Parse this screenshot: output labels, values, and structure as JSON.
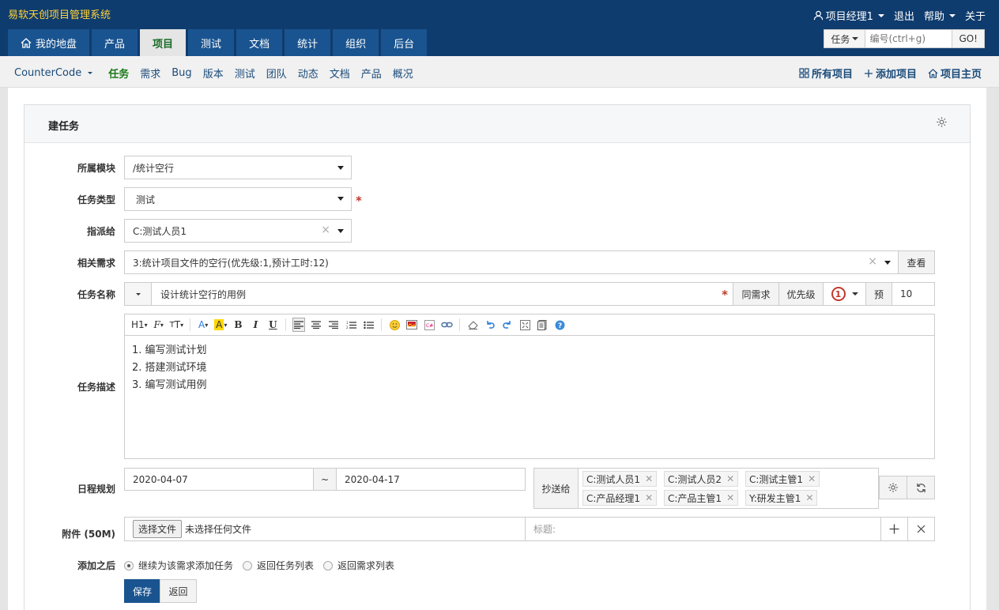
{
  "app": {
    "name": "易软天创项目管理系统"
  },
  "user_menu": {
    "user": "项目经理1",
    "logout": "退出",
    "help": "帮助",
    "about": "关于"
  },
  "main_nav": [
    {
      "label": "我的地盘",
      "active": false,
      "icon": "home-icon"
    },
    {
      "label": "产品",
      "active": false
    },
    {
      "label": "项目",
      "active": true
    },
    {
      "label": "测试",
      "active": false
    },
    {
      "label": "文档",
      "active": false
    },
    {
      "label": "统计",
      "active": false
    },
    {
      "label": "组织",
      "active": false
    },
    {
      "label": "后台",
      "active": false
    }
  ],
  "search": {
    "type": "任务",
    "placeholder": "编号(ctrl+g)",
    "go": "GO!"
  },
  "sub_nav": {
    "project": "CounterCode",
    "links": [
      {
        "label": "任务",
        "active": true
      },
      {
        "label": "需求",
        "active": false
      },
      {
        "label": "Bug",
        "active": false
      },
      {
        "label": "版本",
        "active": false
      },
      {
        "label": "测试",
        "active": false
      },
      {
        "label": "团队",
        "active": false
      },
      {
        "label": "动态",
        "active": false
      },
      {
        "label": "文档",
        "active": false
      },
      {
        "label": "产品",
        "active": false
      },
      {
        "label": "概况",
        "active": false
      }
    ],
    "right": {
      "all": "所有项目",
      "add": "添加项目",
      "home": "项目主页"
    }
  },
  "form": {
    "title": "建任务",
    "module": {
      "label": "所属模块",
      "value": "/统计空行"
    },
    "type": {
      "label": "任务类型",
      "value": "测试"
    },
    "assign": {
      "label": "指派给",
      "value": "C:测试人员1"
    },
    "story": {
      "label": "相关需求",
      "value": "3:统计项目文件的空行(优先级:1,预计工时:12)",
      "view": "查看"
    },
    "name": {
      "label": "任务名称",
      "value": "设计统计空行的用例",
      "same_story": "同需求",
      "priority_label": "优先级",
      "priority_value": "1",
      "estimate_label": "预",
      "estimate_value": "10"
    },
    "desc": {
      "label": "任务描述",
      "lines": [
        "1. 编写测试计划",
        "2. 搭建测试环境",
        "3. 编写测试用例"
      ]
    },
    "schedule": {
      "label": "日程规划",
      "start": "2020-04-07",
      "sep": "~",
      "end": "2020-04-17"
    },
    "cc": {
      "label": "抄送给",
      "tags": [
        "C:测试人员1",
        "C:测试人员2",
        "C:测试主管1",
        "C:产品经理1",
        "C:产品主管1",
        "Y:研发主管1"
      ]
    },
    "attach": {
      "label": "附件 (50M)",
      "choose": "选择文件",
      "none": "未选择任何文件",
      "title_placeholder": "标题:"
    },
    "after": {
      "label": "添加之后",
      "options": [
        "继续为该需求添加任务",
        "返回任务列表",
        "返回需求列表"
      ],
      "selected": 0
    },
    "save": "保存",
    "back": "返回"
  }
}
